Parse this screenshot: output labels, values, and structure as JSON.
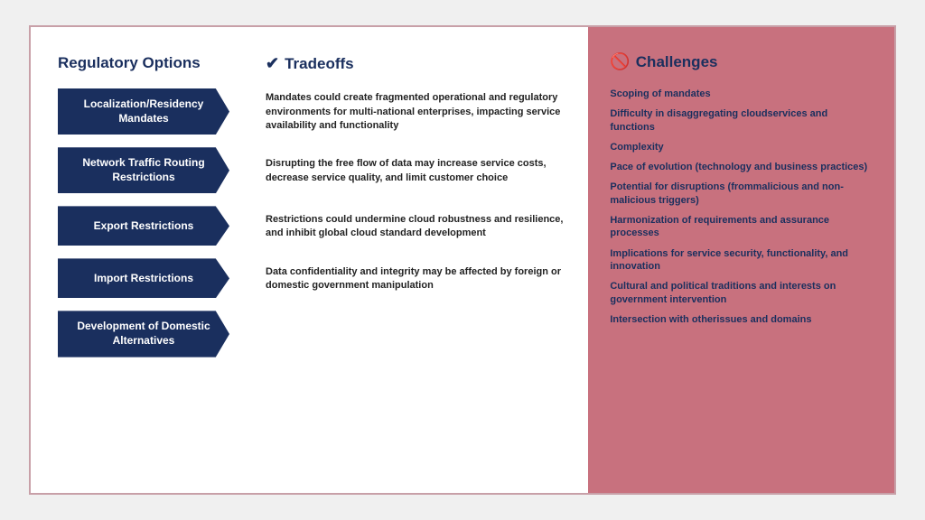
{
  "header": {
    "reg_title": "Regulatory Options",
    "tradeoffs_title": "Tradeoffs",
    "tradeoffs_icon": "✔",
    "challenges_title": "Challenges",
    "challenges_icon": "🚫"
  },
  "regulatory_options": [
    {
      "label": "Localization/Residency\nMandates"
    },
    {
      "label": "Network Traffic Routing\nRestrictions"
    },
    {
      "label": "Export Restrictions"
    },
    {
      "label": "Import Restrictions"
    },
    {
      "label": "Development of Domestic\nAlternatives"
    }
  ],
  "tradeoffs": [
    {
      "text": "Mandates could create fragmented operational and regulatory environments for multi-national enterprises, impacting service availability and functionality"
    },
    {
      "text": "Disrupting the free flow of data may increase service costs, decrease service quality, and limit customer choice"
    },
    {
      "text": "Restrictions could undermine cloud robustness and resilience, and inhibit global cloud standard development"
    },
    {
      "text": "Data confidentiality and integrity may be affected by foreign or domestic government manipulation"
    },
    {
      "text": ""
    }
  ],
  "challenges": [
    {
      "text": "Scoping of mandates"
    },
    {
      "text": "Difficulty in disaggregating cloudservices and functions"
    },
    {
      "text": "Complexity"
    },
    {
      "text": "Pace of evolution (technology and business practices)"
    },
    {
      "text": "Potential for disruptions (frommalicious and non-malicious triggers)"
    },
    {
      "text": "Harmonization of requirements and assurance processes"
    },
    {
      "text": "Implications for service security, functionality, and innovation"
    },
    {
      "text": "Cultural and political traditions and interests on government intervention"
    },
    {
      "text": "Intersection with otherissues and domains"
    }
  ]
}
